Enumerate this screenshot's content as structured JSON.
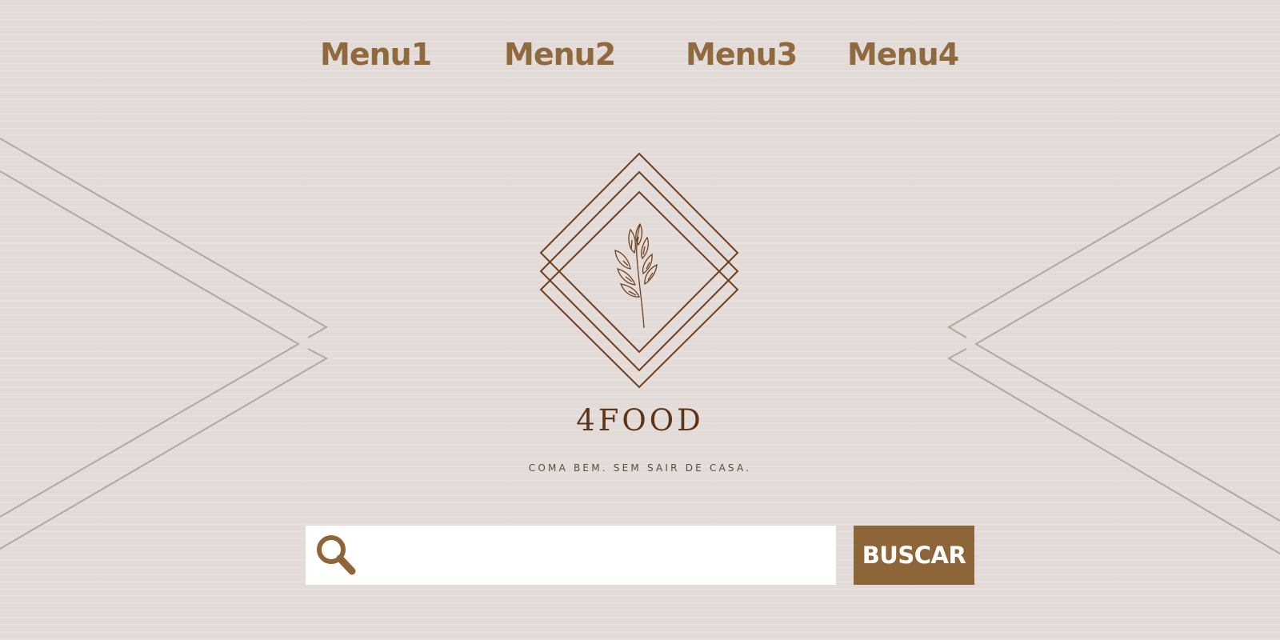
{
  "nav": {
    "items": [
      {
        "label": "Menu1"
      },
      {
        "label": "Menu2"
      },
      {
        "label": "Menu3"
      },
      {
        "label": "Menu4"
      }
    ]
  },
  "logo": {
    "emblem_icon": "diamond-wheat-icon",
    "brand_name": "4FOOD",
    "tagline": "COMA BEM. SEM SAIR DE CASA."
  },
  "search": {
    "icon": "search-icon",
    "value": "",
    "placeholder": "",
    "button_label": "BUSCAR"
  },
  "colors": {
    "background": "#e3dbd8",
    "accent": "#8d6538",
    "nav_text": "#8f6a3e",
    "brand_text": "#5c3417",
    "decor_lines": "#b5a69f"
  }
}
